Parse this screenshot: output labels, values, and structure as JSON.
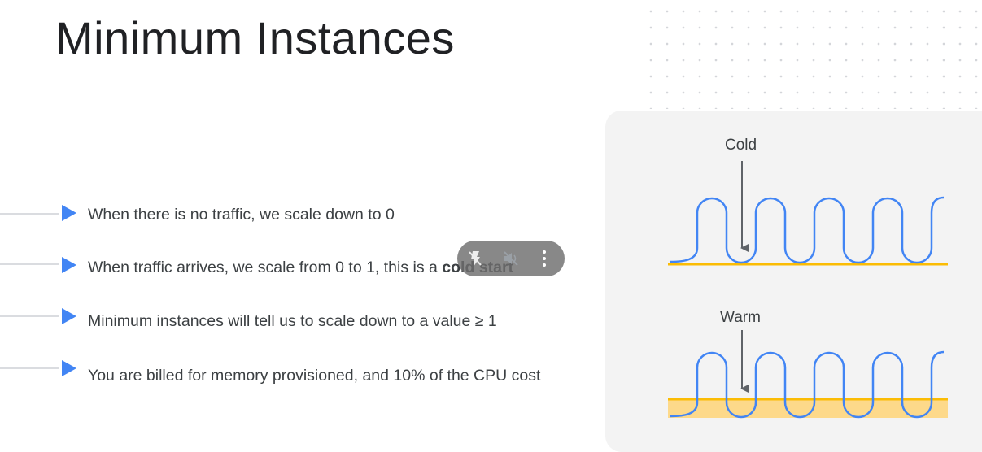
{
  "slide": {
    "title": "Minimum Instances",
    "bullets": [
      {
        "text": "When there is no traffic, we scale down to 0"
      },
      {
        "text_before": "When traffic arrives, we scale from 0 to 1, this is a ",
        "text_bold": "cold start"
      },
      {
        "text": "Minimum instances will tell us to scale down to a value ≥ 1"
      },
      {
        "text": "You are billed for memory provisioned, and 10% of the CPU cost"
      }
    ]
  },
  "diagram": {
    "cold_label": "Cold",
    "warm_label": "Warm",
    "colors": {
      "wave": "#4285f4",
      "baseline": "#fbbc04",
      "warm_fill": "#fdd98a",
      "arrow": "#5f6368",
      "panel": "#f3f3f3"
    }
  },
  "player_controls": {
    "buttons": [
      {
        "icon": "flash-off-icon"
      },
      {
        "icon": "volume-off-icon"
      },
      {
        "icon": "more-vertical-icon"
      }
    ]
  },
  "colors": {
    "bullet_arrow": "#4285f4",
    "text": "#3c4043",
    "title": "#202124"
  }
}
